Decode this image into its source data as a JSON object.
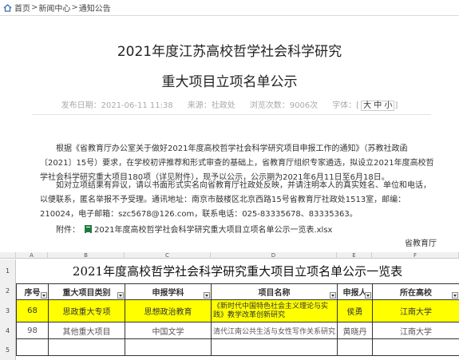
{
  "breadcrumb": {
    "home": "首页",
    "news": "新闻中心",
    "notice": "通知公告"
  },
  "title": {
    "line1": "2021年度江苏高校哲学社会科学研究",
    "line2": "重大项目立项名单公示"
  },
  "meta": {
    "date": "发布日期：2021-06-11 11:38",
    "source": "来源：社政处",
    "views": "浏览次数：9006次",
    "fontsize_label": "字体：[",
    "size_large": "大",
    "size_mid": "中",
    "size_small": "小",
    "fontsize_end": "]"
  },
  "body": {
    "para1": "根据《省教育厅办公室关于做好2021年度高校哲学社会科学研究项目申报工作的通知》（苏教社政函〔2021〕15号）要求，在学校初评推荐和形式审查的基础上，省教育厅组织专家遴选，拟设立2021年度高校哲学社会科学研究重大项目180项（详见附件），现予以公示，公示期为2021年6月11日至6月18日。",
    "para2": "如对立项结果有异议，请以书面形式实名向省教育厅社政处反映，并请注明本人的真实姓名、单位和电话，以便联系，匿名举报不予受理。通讯地址：南京市鼓楼区北京西路15号省教育厅社政处1513室，邮编：210024，电子邮箱：szc5678@126.com，联系电话：025-83335678、83335363。",
    "attach_label": "附件：",
    "attach_file": "2021年度高校哲学社会科学研究重大项目立项名单公示一览表.xlsx",
    "signature": "省教育厅"
  },
  "sheet": {
    "col_letters": [
      "A",
      "B",
      "C",
      "D",
      "E",
      "F"
    ],
    "row_numbers": [
      "1",
      "2",
      "3",
      "4",
      "5"
    ],
    "title": "2021年度高校哲学社会科学研究重大项目立项名单公示一览表",
    "headers": [
      "序号",
      "重大项目类别",
      "申报学科",
      "项目名称",
      "申报人",
      "所在高校"
    ],
    "rows": [
      [
        "68",
        "思政重大专项",
        "思想政治教育",
        "《新时代中国特色社会主义理论与实践》教学改革创新研究",
        "侯勇",
        "江南大学"
      ],
      [
        "98",
        "其他重大项目",
        "中国文学",
        "清代江南公共生活与女性写作关系研究",
        "黄晓丹",
        "江南大学"
      ]
    ]
  },
  "colors": {
    "highlight": "#ffff00",
    "grid": "#333333"
  }
}
